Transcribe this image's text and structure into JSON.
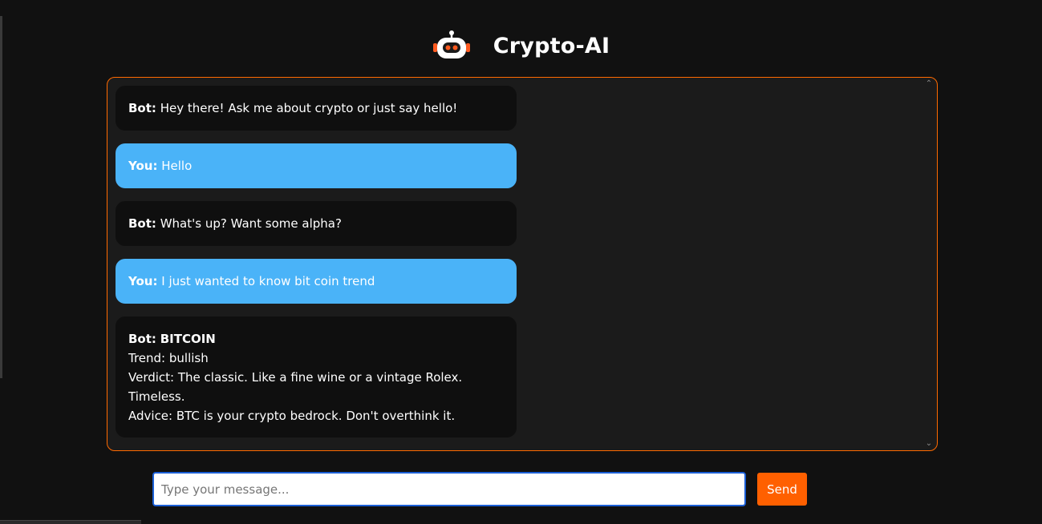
{
  "header": {
    "title": "Crypto-AI",
    "icon": "robot-icon"
  },
  "colors": {
    "accent": "#ff6000",
    "user_bubble": "#4ab3f8",
    "bot_bubble": "#0f0f0f",
    "background": "#111111",
    "panel": "#1b1b1b"
  },
  "chat": {
    "messages": [
      {
        "sender": "Bot:",
        "text": "Hey there! Ask me about crypto or just say hello!"
      },
      {
        "sender": "You:",
        "text": "Hello"
      },
      {
        "sender": "Bot:",
        "text": "What's up? Want some alpha?"
      },
      {
        "sender": "You:",
        "text": "I just wanted to know bit coin trend"
      },
      {
        "sender": "Bot:",
        "title": "BITCOIN",
        "lines": [
          "Trend: bullish",
          "Verdict: The classic. Like a fine wine or a vintage Rolex. Timeless.",
          "Advice: BTC is your crypto bedrock. Don't overthink it."
        ]
      }
    ]
  },
  "composer": {
    "placeholder": "Type your message...",
    "value": "",
    "send_label": "Send"
  }
}
